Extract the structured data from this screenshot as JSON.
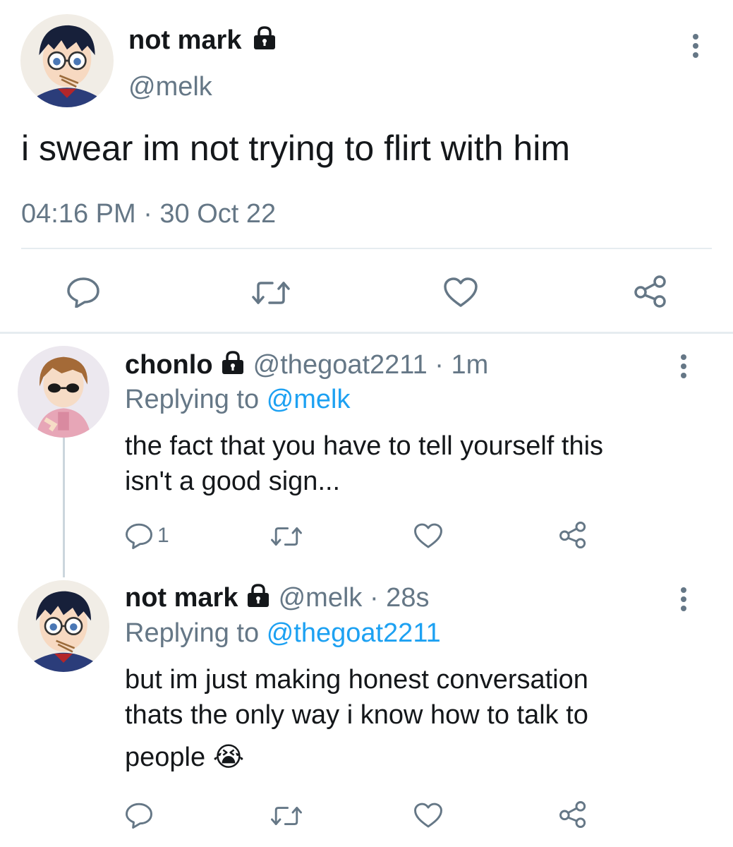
{
  "main_tweet": {
    "display_name": "not mark",
    "handle": "@melk",
    "text": "i swear im not trying to flirt with him",
    "timestamp": "04:16 PM · 30 Oct 22",
    "icons": {
      "more": "more-vertical-icon",
      "lock": "lock-icon"
    }
  },
  "main_actions": [
    {
      "icon": "reply-icon"
    },
    {
      "icon": "retweet-icon"
    },
    {
      "icon": "like-icon"
    },
    {
      "icon": "share-icon"
    }
  ],
  "replies": [
    {
      "display_name": "chonlo",
      "handle_time": "@thegoat2211 · 1m",
      "replying_prefix": "Replying to",
      "replying_to": "@melk",
      "text_line1": "the fact that you have to tell yourself this",
      "text_line2": "isn't a good sign...",
      "reply_count": "1"
    },
    {
      "display_name": "not mark",
      "handle_time": "@melk · 28s",
      "replying_prefix": "Replying to",
      "replying_to": "@thegoat2211",
      "text_line1": "but im just making honest conversation",
      "text_line2": "thats the only way i know how to talk to",
      "text_line3": "people",
      "emoji": "😭",
      "reply_count": ""
    }
  ],
  "colors": {
    "link": "#1da1f2",
    "muted": "#657786",
    "text": "#14171a",
    "divider": "#e6ecf0"
  }
}
